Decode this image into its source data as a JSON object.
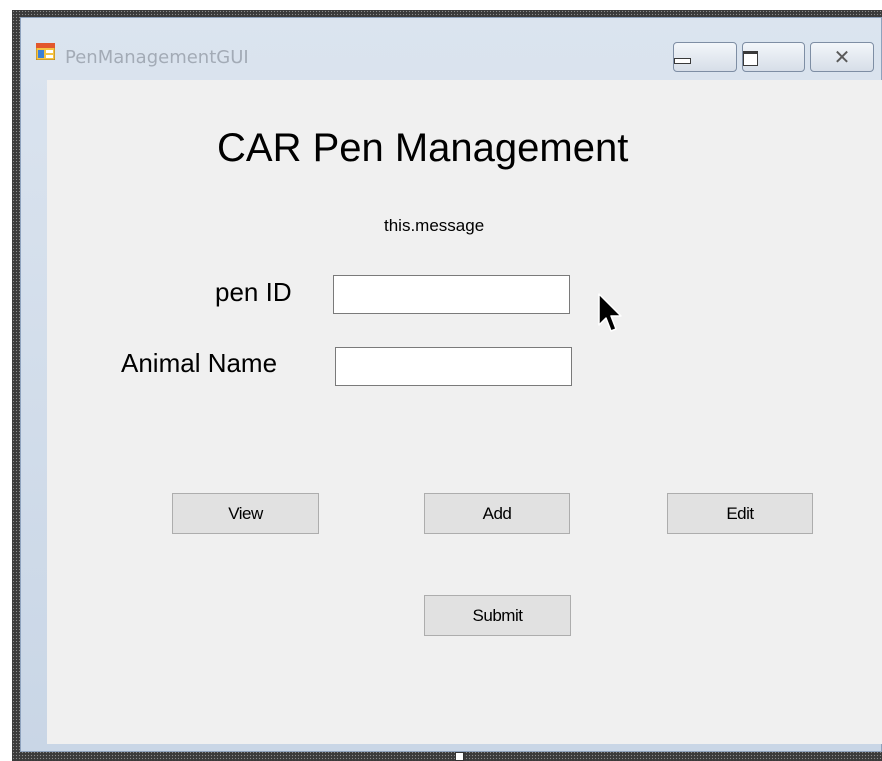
{
  "window": {
    "title": "PenManagementGUI",
    "icon": "windows-forms-app-icon",
    "caption_buttons": [
      {
        "name": "minimize",
        "icon": "minimize-icon"
      },
      {
        "name": "maximize",
        "icon": "maximize-icon"
      },
      {
        "name": "close",
        "icon": "close-icon",
        "glyph": "✕"
      }
    ]
  },
  "form": {
    "heading": "CAR Pen Management",
    "message": "this.message",
    "fields": {
      "pen_id": {
        "label": "pen ID",
        "value": ""
      },
      "animal_name": {
        "label": "Animal Name",
        "value": ""
      }
    },
    "buttons": {
      "view": "View",
      "add": "Add",
      "edit": "Edit",
      "submit": "Submit"
    }
  },
  "colors": {
    "client_background": "#f0f0f0",
    "button_face": "#e1e1e1",
    "titlebar": "#dbe4ef",
    "title_text": "#a3abb6"
  },
  "cursor": {
    "icon": "arrow-cursor-icon"
  }
}
